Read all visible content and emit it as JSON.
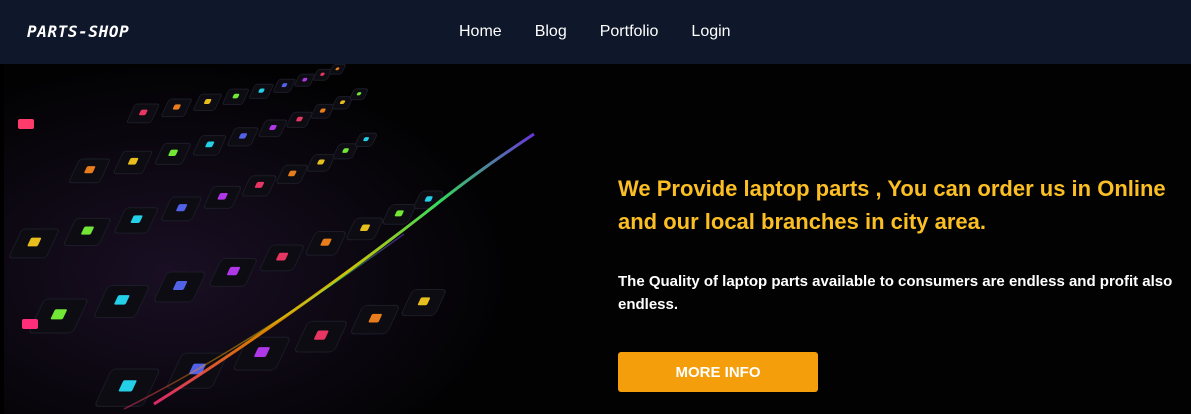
{
  "navbar": {
    "brand": "PARTS-SHOP",
    "links": [
      "Home",
      "Blog",
      "Portfolio",
      "Login"
    ]
  },
  "hero": {
    "headline": "We Provide laptop parts , You can order us in Online and our local branches in city area.",
    "subtext": "The Quality of laptop parts available to consumers are endless and profit also endless.",
    "button_label": "MORE INFO",
    "image_subject": "rgb-backlit-keyboard"
  },
  "colors": {
    "navbar_bg": "#0f172a",
    "headline": "#fbbf24",
    "button_bg": "#f59e0b",
    "hero_bg": "#020203"
  }
}
